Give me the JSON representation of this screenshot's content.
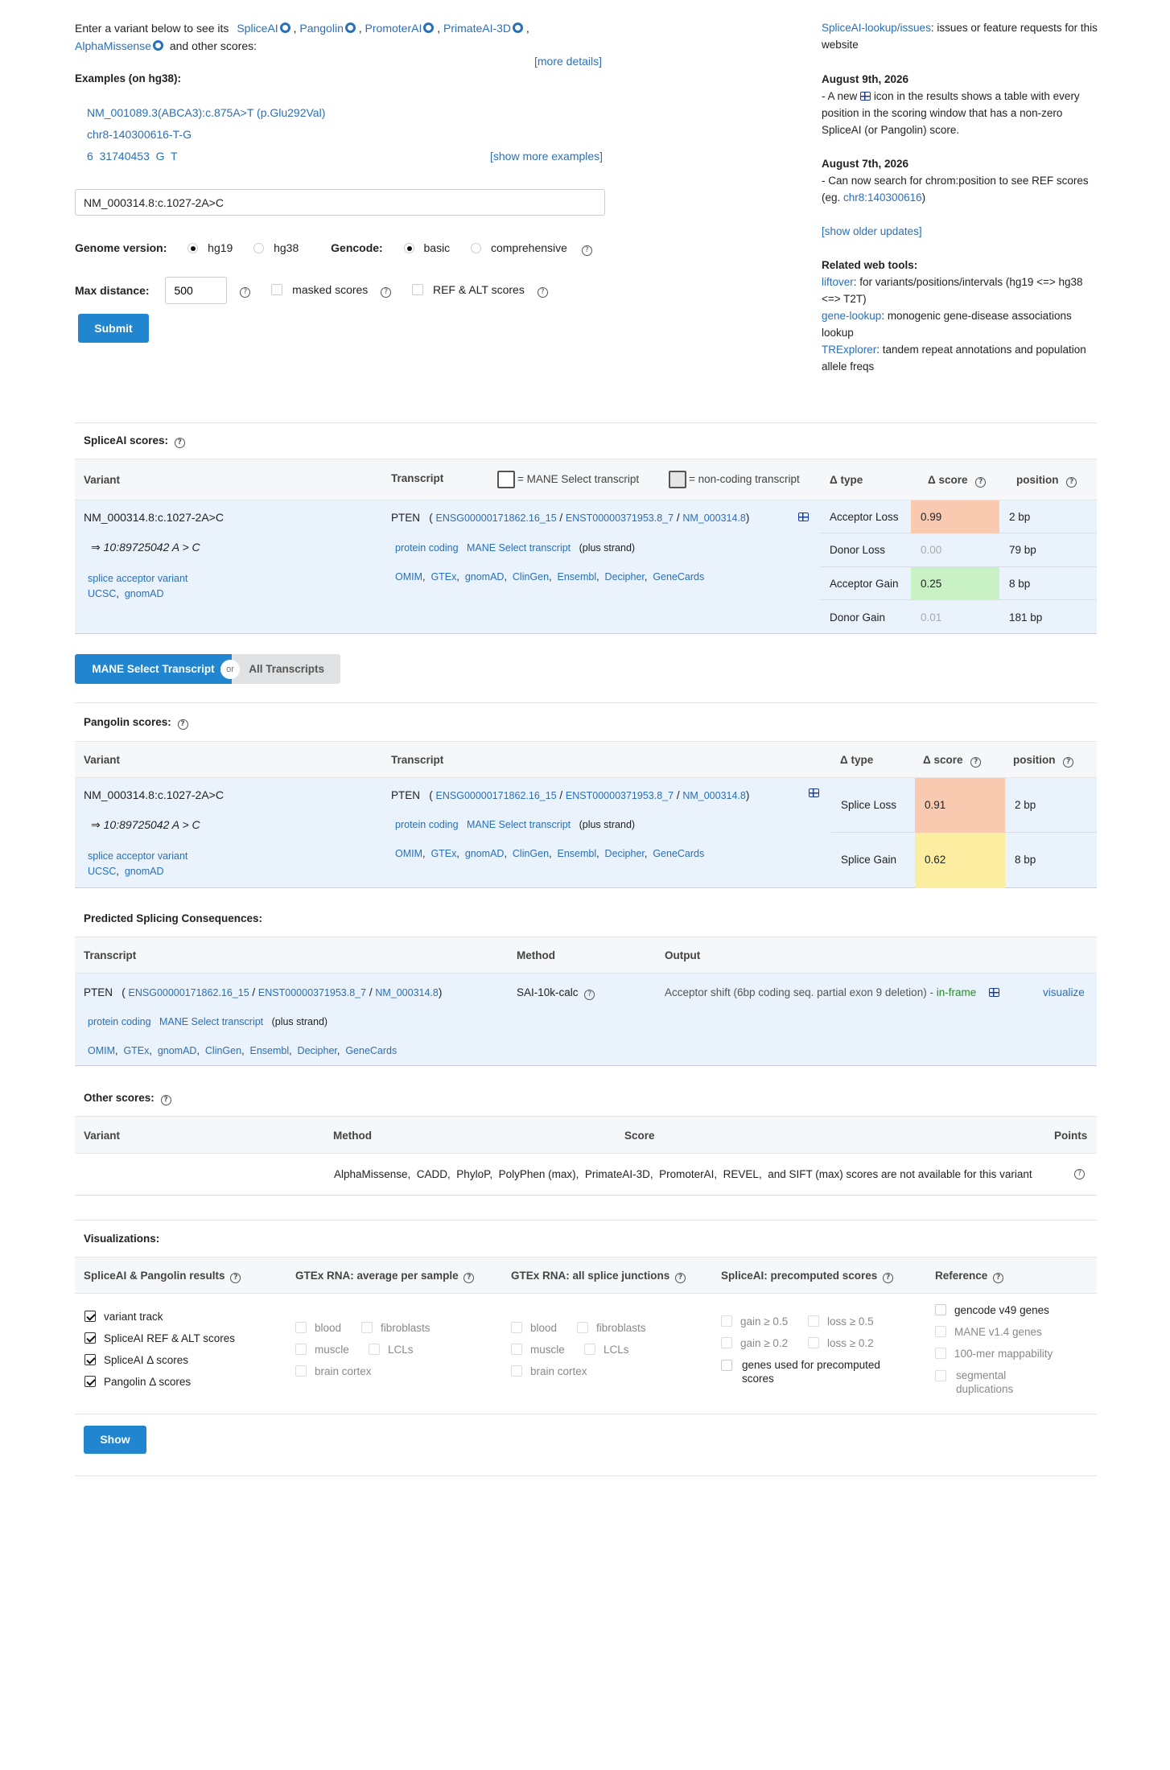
{
  "intro": {
    "prefix": "Enter a variant below to see its",
    "tools": [
      "SpliceAI",
      "Pangolin",
      "PromoterAI",
      "PrimateAI-3D",
      "AlphaMissense"
    ],
    "suffix": "and other scores:",
    "more_details": "[more details]"
  },
  "examples": {
    "title": "Examples   (on hg38):",
    "items": [
      "NM_001089.3(ABCA3):c.875A>T (p.Glu292Val)",
      "chr8-140300616-T-G",
      "6  31740453  G  T"
    ],
    "show_more": "[show more examples]"
  },
  "search": {
    "value": "NM_000314.8:c.1027-2A>C"
  },
  "genome": {
    "label": "Genome version:",
    "options": [
      "hg19",
      "hg38"
    ],
    "selected": "hg19"
  },
  "gencode": {
    "label": "Gencode:",
    "options": [
      "basic",
      "comprehensive"
    ],
    "selected": "basic"
  },
  "max_distance": {
    "label": "Max distance:",
    "value": "500"
  },
  "options": {
    "masked": "masked scores",
    "refalt": "REF & ALT scores"
  },
  "submit": "Submit",
  "sidebar": {
    "issues_link": "SpliceAI-lookup/issues",
    "issues_text": ": issues or feature requests for this website",
    "news": [
      {
        "date": "August 9th, 2026",
        "text_a": "- A new",
        "text_b": "icon in the results shows a table with every position in the scoring window that has a non-zero SpliceAI (or Pangolin) score."
      },
      {
        "date": "August 7th, 2026",
        "text_a": "- Can now search for chrom:position to see REF scores (eg. ",
        "link": "chr8:140300616",
        "text_b": ")"
      }
    ],
    "older": "[show older updates]",
    "related_title": "Related web tools:",
    "tools": [
      {
        "name": "liftover",
        "desc": ": for variants/positions/intervals (hg19 <=> hg38 <=> T2T)"
      },
      {
        "name": "gene-lookup",
        "desc": ": monogenic gene-disease associations lookup"
      },
      {
        "name": "TRExplorer",
        "desc": ": tandem repeat annotations and population allele freqs"
      }
    ]
  },
  "variant": {
    "name": "NM_000314.8:c.1027-2A>C",
    "coords": "⇒ 10:89725042 A > C",
    "consequence": "splice acceptor variant",
    "links": [
      "UCSC",
      "gnomAD"
    ]
  },
  "transcript": {
    "gene": "PTEN",
    "ensg": "ENSG00000171862.16_15",
    "enst": "ENST00000371953.8_7",
    "nm": "NM_000314.8",
    "biotype": "protein coding",
    "mane": "MANE Select transcript",
    "strand": "(plus strand)",
    "dblinks": [
      "OMIM",
      "GTEx",
      "gnomAD",
      "ClinGen",
      "Ensembl",
      "Decipher",
      "GeneCards"
    ]
  },
  "spliceai": {
    "title": "SpliceAI scores:",
    "headers": {
      "variant": "Variant",
      "transcript": "Transcript",
      "mane_legend": "= MANE Select transcript",
      "noncoding_legend": "= non-coding transcript",
      "type": "Δ type",
      "score": "Δ score",
      "position": "position"
    },
    "rows": [
      {
        "type": "Acceptor Loss",
        "score": "0.99",
        "position": "2 bp",
        "color": "#f9c9b0"
      },
      {
        "type": "Donor Loss",
        "score": "0.00",
        "position": "79 bp",
        "color": ""
      },
      {
        "type": "Acceptor Gain",
        "score": "0.25",
        "position": "8 bp",
        "color": "#c9f2c4"
      },
      {
        "type": "Donor Gain",
        "score": "0.01",
        "position": "181 bp",
        "color": ""
      }
    ]
  },
  "toggle": {
    "mane": "MANE Select Transcript",
    "or": "or",
    "all": "All Transcripts"
  },
  "pangolin": {
    "title": "Pangolin scores:",
    "headers": {
      "variant": "Variant",
      "transcript": "Transcript",
      "type": "Δ type",
      "score": "Δ score",
      "position": "position"
    },
    "rows": [
      {
        "type": "Splice Loss",
        "score": "0.91",
        "position": "2 bp",
        "color": "#f9c9b0"
      },
      {
        "type": "Splice Gain",
        "score": "0.62",
        "position": "8 bp",
        "color": "#fbeea0"
      }
    ]
  },
  "consequences": {
    "title": "Predicted Splicing Consequences:",
    "headers": {
      "transcript": "Transcript",
      "method": "Method",
      "output": "Output"
    },
    "method": "SAI-10k-calc",
    "output": "Acceptor shift (6bp coding seq. partial exon 9 deletion) - ",
    "frame": "in-frame",
    "visualize": "visualize"
  },
  "other": {
    "title": "Other scores:",
    "headers": {
      "variant": "Variant",
      "method": "Method",
      "score": "Score",
      "points": "Points"
    },
    "message": "AlphaMissense,  CADD,  PhyloP,  PolyPhen (max),  PrimateAI-3D,  PromoterAI,  REVEL,  and SIFT (max) scores are not available for this variant"
  },
  "visualizations": {
    "title": "Visualizations:",
    "columns": [
      "SpliceAI & Pangolin results",
      "GTEx RNA: average per sample",
      "GTEx RNA: all splice junctions",
      "SpliceAI: precomputed scores",
      "Reference"
    ],
    "results": [
      "variant track",
      "SpliceAI REF & ALT scores",
      "SpliceAI Δ  scores",
      "Pangolin Δ  scores"
    ],
    "gtex_avg": [
      "blood",
      "fibroblasts",
      "muscle",
      "LCLs",
      "brain cortex"
    ],
    "gtex_junc": [
      "blood",
      "fibroblasts",
      "muscle",
      "LCLs",
      "brain cortex"
    ],
    "precomputed": [
      "gain ≥ 0.5",
      "loss ≥ 0.5",
      "gain ≥ 0.2",
      "loss ≥ 0.2",
      "genes used for precomputed scores"
    ],
    "reference": [
      "gencode v49 genes",
      "MANE v1.4 genes",
      "100-mer mappability",
      "segmental duplications"
    ],
    "show": "Show"
  }
}
